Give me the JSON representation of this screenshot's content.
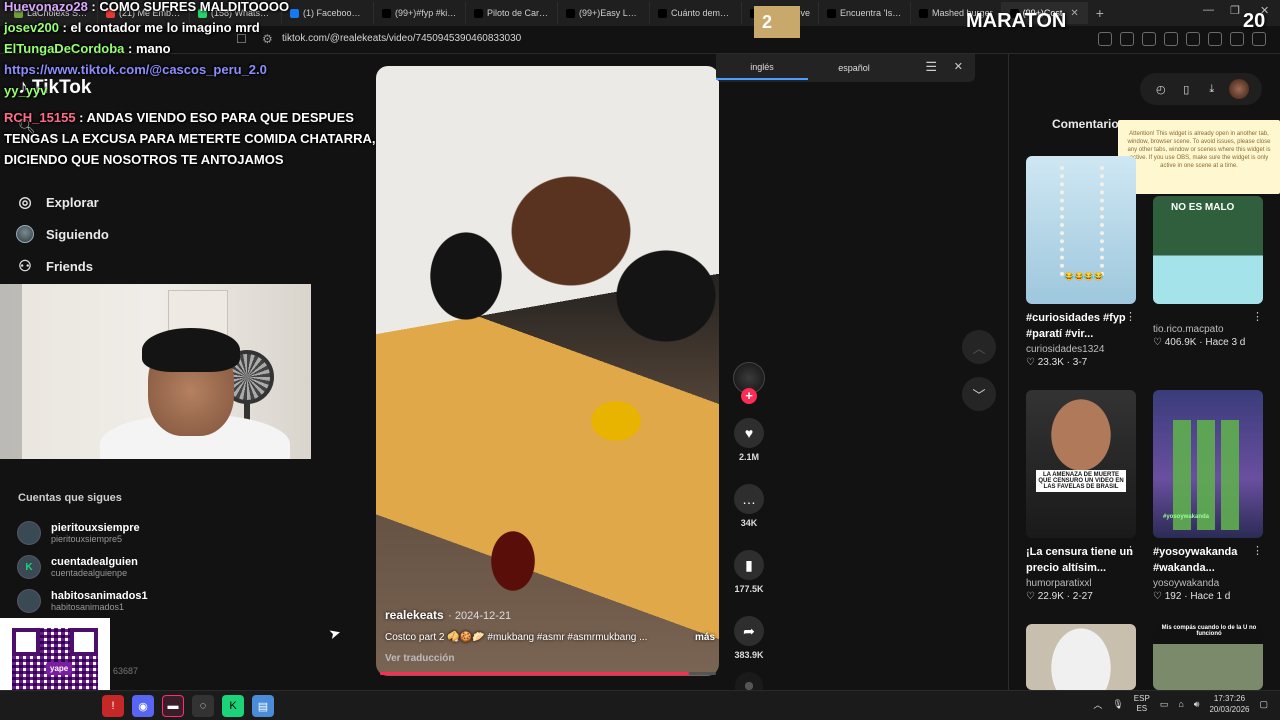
{
  "browser": {
    "tabs": [
      {
        "label": "LaCholexs Stream",
        "color": "#6f9e3b"
      },
      {
        "label": "(21) Me Emborra",
        "color": "#e53935"
      },
      {
        "label": "(158) WhatsApp",
        "color": "#25d366"
      },
      {
        "label": "(1) Facebook Ma",
        "color": "#1877f2"
      },
      {
        "label": "(99+)#fyp #kickp",
        "color": "#000000"
      },
      {
        "label": "Piloto de Carrera",
        "color": "#000000"
      },
      {
        "label": "(99+)Easy Leftov",
        "color": "#000000"
      },
      {
        "label": "Cuánto demoras",
        "color": "#000000"
      },
      {
        "label": "El conmove",
        "color": "#000000"
      },
      {
        "label": "Encuentra 'Is 1 m",
        "color": "#000000"
      },
      {
        "label": "Mashed burger",
        "color": "#000000"
      },
      {
        "label": "(99+)Cost",
        "color": "#000000",
        "active": true
      }
    ],
    "url": "tiktok.com/@realekeats/video/7450945390460833030"
  },
  "overlay": {
    "chat": [
      {
        "user": "Huevonazo28",
        "text": "COMO SUFRES MALDITOOOO",
        "color": "#d9a7ff"
      },
      {
        "user": "josev200",
        "text": "el contador me lo imagino mrd",
        "color": "#96ff73"
      },
      {
        "user": "ElTungaDeCordoba",
        "text": "mano",
        "color": "#96ff73"
      },
      {
        "user": "",
        "text": "https://www.tiktok.com/@cascos_peru_2.0",
        "link": true
      },
      {
        "user": "yy_yyv",
        "text": "",
        "color": "#96ff73"
      }
    ],
    "long_msg": {
      "user": "RCH_15155",
      "text": "ANDAS VIENDO ESO PARA QUE DESPUES TENGAS LA EXCUSA PARA METERTE COMIDA CHATARRA, DICIENDO QUE NOSOTROS TE ANTOJAMOS"
    },
    "box_number": "2",
    "title": "MARATON",
    "count": "20"
  },
  "tiktok": {
    "logo": "TikTok",
    "nav": [
      {
        "label": "Explorar",
        "icon": "compass-icon"
      },
      {
        "label": "Siguiendo",
        "icon": "avatar-icon"
      },
      {
        "label": "Friends",
        "icon": "friends-icon"
      }
    ],
    "following_title": "Cuentas que sigues",
    "following": [
      {
        "name": "pieritouxsiempre",
        "handle": "pieritouxsiempre5",
        "initial": ""
      },
      {
        "name": "cuentadealguien",
        "handle": "cuentadealguienpe",
        "initial": "K"
      },
      {
        "name": "habitosanimados1",
        "handle": "habitosanimados1",
        "initial": ""
      }
    ],
    "following_tail": "63687",
    "qr_badge": "yape"
  },
  "video": {
    "author": "realekeats",
    "date": "2024-12-21",
    "description": "Costco part 2 🥠🍪🥟 #mukbang #asmr #asmrmukbang ...",
    "more": "más",
    "translate": "Ver traducción",
    "progress": 0.92,
    "likes": "2.1M",
    "comments": "34K",
    "saves": "177.5K",
    "shares": "383.9K"
  },
  "translate_bar": {
    "from": "inglés",
    "to": "español"
  },
  "panel": {
    "tab": "Comentarios",
    "attention": "Attention! This widget is already open in another tab, window, browser scene. To avoid issues, please close any other tabs, window or scenes where this widget is active. If you use OBS, make sure the widget is only active in one scene at a time.",
    "related": [
      {
        "title": "#curiosidades #fyp #paratí #vir...",
        "author": "curiosidades1324",
        "likes": "23.3K",
        "age": "3-7",
        "thumb_text": "😂😂😂😂",
        "bg": "#c6e1ef"
      },
      {
        "title": "",
        "author": "tio.rico.macpato",
        "likes": "406.9K",
        "age": "Hace 3 d",
        "thumb_text": "NO ES MALO",
        "bg": "#2e5a3b"
      },
      {
        "title": "¡La censura tiene un precio altísim...",
        "author": "humorparatixxl",
        "likes": "22.9K",
        "age": "2-27",
        "thumb_text": "LA AMENAZA DE MUERTE QUE CENSURO UN VIDEO EN LAS FAVELAS DE BRASIL",
        "bg": "#2b2b2b"
      },
      {
        "title": "#yosoywakanda #wakanda...",
        "author": "yosoywakanda",
        "likes": "192",
        "age": "Hace 1 d",
        "thumb_text": "#yosoywakanda",
        "bg": "#3a3c6a"
      },
      {
        "title": "",
        "author": "",
        "likes": "",
        "age": "",
        "thumb_text": "",
        "bg": "#d8cfc2"
      },
      {
        "title": "",
        "author": "",
        "likes": "",
        "age": "",
        "thumb_text": "Mis compás cuando lo de la U no funcionó",
        "bg": "#222222"
      }
    ]
  },
  "taskbar": {
    "lang_top": "ESP",
    "lang_bottom": "ES",
    "time": "17:37:26",
    "date": "20/03/2026"
  }
}
